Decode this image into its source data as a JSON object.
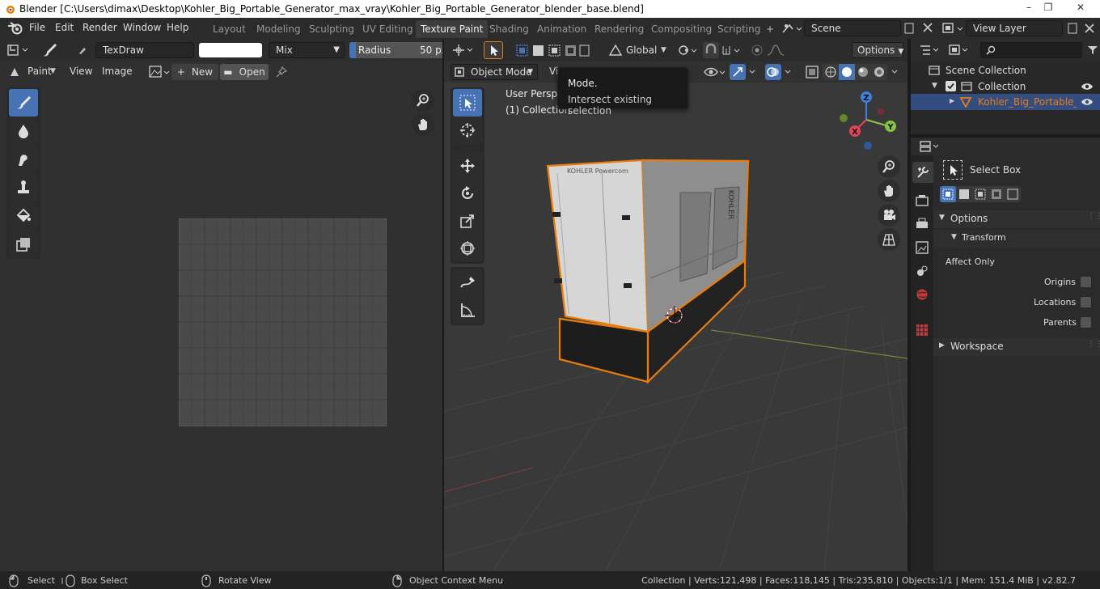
{
  "window": {
    "title": "Blender [C:\\Users\\dimax\\Desktop\\Kohler_Big_Portable_Generator_max_vray\\Kohler_Big_Portable_Generator_blender_base.blend]",
    "minimize": "–",
    "restore": "❐",
    "close": "✕"
  },
  "menus": [
    "File",
    "Edit",
    "Render",
    "Window",
    "Help"
  ],
  "workspaces": [
    "Layout",
    "Modeling",
    "Sculpting",
    "UV Editing",
    "Texture Paint",
    "Shading",
    "Animation",
    "Rendering",
    "Compositing",
    "Scripting"
  ],
  "active_workspace": "Texture Paint",
  "add_workspace": "+",
  "scene": {
    "label": "Scene"
  },
  "view_layer": {
    "label": "View Layer"
  },
  "paint_header": {
    "brush": "TexDraw",
    "blend": "Mix",
    "radius_label": "Radius",
    "radius_value": "50 px"
  },
  "image_editor": {
    "mode": "Paint",
    "view": "View",
    "image": "Image",
    "new": "New",
    "open": "Open"
  },
  "viewport": {
    "transform": "Global",
    "options": "Options",
    "mode": "Object Mode",
    "view_trunc": "Vi",
    "perspective": "User Perspective",
    "collection": "(1) Collection",
    "generator_brand": "KOHLER Powercom",
    "side_brand": "KOHLER",
    "axis_x": "X",
    "axis_y": "Y",
    "axis_z": "Z"
  },
  "tooltip": {
    "title": "Mode.",
    "desc": "Intersect existing selection"
  },
  "outliner": {
    "scene_collection": "Scene Collection",
    "collection": "Collection",
    "object": "Kohler_Big_Portable_Generator"
  },
  "properties": {
    "tool": "Select Box",
    "options": "Options",
    "transform": "Transform",
    "affect_only": "Affect Only",
    "origins": "Origins",
    "locations": "Locations",
    "parents": "Parents",
    "workspace": "Workspace"
  },
  "statusbar": {
    "select": "Select",
    "box_select": "Box Select",
    "rotate": "Rotate View",
    "context": "Object Context Menu",
    "stats": "Collection | Verts:121,498 | Faces:118,145 | Tris:235,810 | Objects:1/1 | Mem: 151.4 MiB | v2.82.7"
  },
  "colors": {
    "accent": "#4772b3",
    "selection": "#e87d0d",
    "axis_x": "#e44357",
    "axis_y": "#8bc43f",
    "axis_z": "#3f7fe0"
  }
}
